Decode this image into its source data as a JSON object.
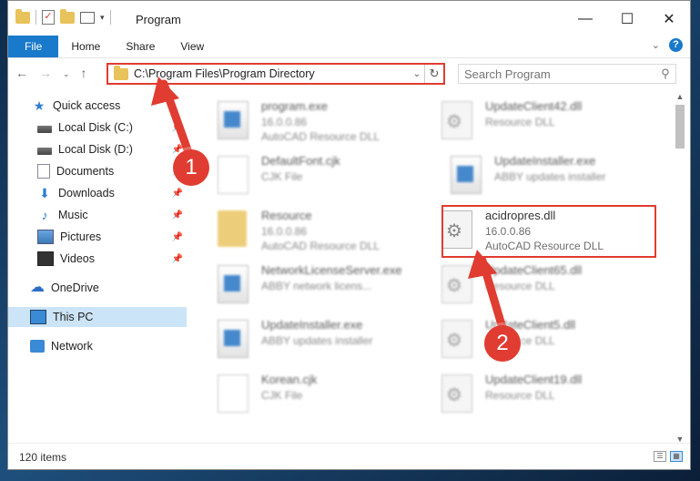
{
  "window": {
    "title": "Program",
    "controls": {
      "minimize": "—",
      "maximize": "☐",
      "close": "✕"
    }
  },
  "ribbon": {
    "tabs": [
      {
        "label": "File",
        "active": true
      },
      {
        "label": "Home"
      },
      {
        "label": "Share"
      },
      {
        "label": "View"
      }
    ],
    "help": "?"
  },
  "navigation": {
    "address": "C:\\Program Files\\Program Directory",
    "search_placeholder": "Search Program"
  },
  "sidebar": {
    "items": [
      {
        "label": "Quick access",
        "icon": "star-icon"
      },
      {
        "label": "Local Disk (C:)",
        "icon": "disk-icon",
        "pinned": true
      },
      {
        "label": "Local Disk (D:)",
        "icon": "disk-icon",
        "pinned": true
      },
      {
        "label": "Documents",
        "icon": "documents-icon",
        "pinned": true
      },
      {
        "label": "Downloads",
        "icon": "download-icon",
        "pinned": true
      },
      {
        "label": "Music",
        "icon": "music-icon",
        "pinned": true
      },
      {
        "label": "Pictures",
        "icon": "pictures-icon",
        "pinned": true
      },
      {
        "label": "Videos",
        "icon": "videos-icon",
        "pinned": true
      },
      {
        "label": "OneDrive",
        "icon": "cloud-icon"
      },
      {
        "label": "This PC",
        "icon": "computer-icon",
        "selected": true
      },
      {
        "label": "Network",
        "icon": "network-icon"
      }
    ]
  },
  "files": [
    {
      "name": "program.exe",
      "line1": "16.0.0.86",
      "line2": "AutoCAD   Resource DLL",
      "icon": "exe-icon"
    },
    {
      "name": "UpdateClient42.dll",
      "line1": "Resource DLL",
      "icon": "dll-icon"
    },
    {
      "name": "DefaultFont.cjk",
      "line1": "CJK File",
      "icon": "document-icon"
    },
    {
      "name": "UpdateInstaller.exe",
      "line1": "ABBY updates installer",
      "icon": "exe-icon"
    },
    {
      "name": "Resource",
      "line1": "16.0.0.86",
      "line2": "AutoCAD   Resource DLL",
      "icon": "folder-icon"
    },
    {
      "name": "acidropres.dll",
      "line1": "16.0.0.86",
      "line2": "AutoCAD   Resource DLL",
      "icon": "dll-icon",
      "highlighted": true
    },
    {
      "name": "NetworkLicenseServer.exe",
      "line1": "ABBY network licens...",
      "icon": "exe-icon"
    },
    {
      "name": "UpdateClient65.dll",
      "line1": "Resource DLL",
      "icon": "dll-icon"
    },
    {
      "name": "UpdateInstaller.exe",
      "line1": "ABBY updates installer",
      "icon": "exe-icon"
    },
    {
      "name": "UpdateClient5.dll",
      "line1": "Resource DLL",
      "icon": "dll-icon"
    },
    {
      "name": "Korean.cjk",
      "line1": "CJK File",
      "icon": "document-icon"
    },
    {
      "name": "UpdateClient19.dll",
      "line1": "Resource DLL",
      "icon": "dll-icon"
    }
  ],
  "status": {
    "item_count": "120 items"
  },
  "annotations": {
    "step1": "1",
    "step2": "2",
    "color": "#e03c31"
  }
}
